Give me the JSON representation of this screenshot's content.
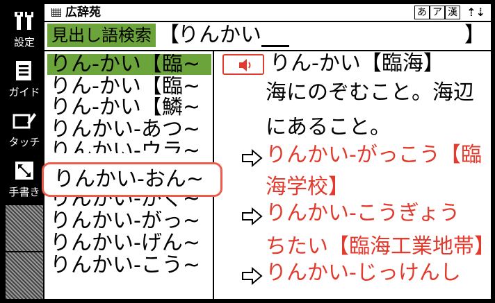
{
  "toolbar": {
    "buttons": [
      {
        "label": "設定",
        "icon": "tools-icon"
      },
      {
        "label": "ガイド",
        "icon": "document-icon"
      },
      {
        "label": "タッチ",
        "icon": "touch-pen-icon"
      },
      {
        "label": "手書き",
        "icon": "expand-icon"
      }
    ]
  },
  "title": {
    "name": "広辞苑",
    "modes": [
      "あ",
      "ア",
      "漢"
    ],
    "scroll_symbol": "⇡⇣"
  },
  "search": {
    "label": "見出し語検索",
    "open_bracket": "【",
    "query": "りんかい",
    "close_bracket": "】"
  },
  "candidates": [
    "りん-かい【臨~",
    "りん-かい【臨~",
    "りん-かい【鱗~",
    "りんかい-あつ~",
    "りんかい-ウラ~",
    "りんかい-がく~",
    "りんかい-がっ~",
    "りんかい-げん~",
    "りんかい-こう~"
  ],
  "popup_candidate": "りんかい-おん~",
  "definition": {
    "headword": "りん-かい【臨海】",
    "body_lines": [
      "海にのぞむこと。海辺",
      "にあること。"
    ],
    "refs": [
      {
        "line1": "りんかい-がっこう【臨",
        "line2": "海学校】"
      },
      {
        "line1": "りんかい-こうぎょう",
        "line2": "ちたい【臨海工業地帯】"
      },
      {
        "line1": "りんかい-じっけんし"
      }
    ]
  },
  "colors": {
    "highlight_green": "#6aa43a",
    "link_red": "#e23b2e",
    "popup_border": "#f05a4a"
  }
}
